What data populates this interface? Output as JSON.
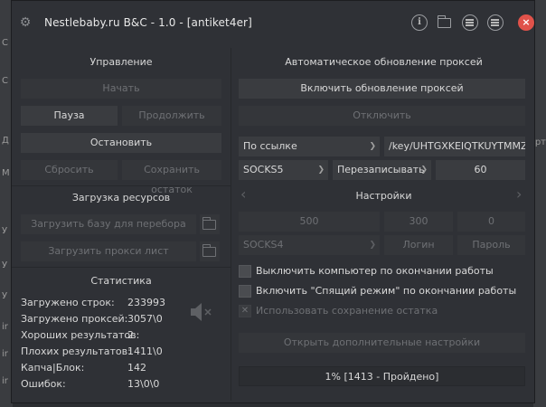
{
  "window": {
    "title": "Nestlebaby.ru B&C - 1.0 - [antiket4er]"
  },
  "background_app": {
    "left_letters": [
      "C",
      "C",
      "Д",
      "М",
      "У",
      "У",
      "У",
      "ir",
      "ir",
      "ir"
    ],
    "right_letters": [
      "рт"
    ]
  },
  "control": {
    "title": "Управление",
    "start": "Начать",
    "pause": "Пауза",
    "resume": "Продолжить",
    "stop": "Остановить",
    "reset": "Сбросить",
    "save_rest": "Сохранить остаток"
  },
  "resources": {
    "title": "Загрузка ресурсов",
    "load_base": "Загрузить базу для перебора",
    "load_proxy": "Загрузить прокси лист"
  },
  "stats": {
    "title": "Статистика",
    "rows": [
      {
        "label": "Загружено строк:",
        "value": "233993"
      },
      {
        "label": "Загружено проксей:",
        "value": "3057\\0"
      },
      {
        "label": "Хороших результатов:",
        "value": "2"
      },
      {
        "label": "Плохих результатов:",
        "value": "1411\\0"
      },
      {
        "label": "Капча|Блок:",
        "value": "142"
      },
      {
        "label": "Ошибок:",
        "value": "13\\0\\0"
      }
    ]
  },
  "proxy_update": {
    "title": "Автоматическое обновление проксей",
    "enable": "Включить обновление проксей",
    "disable": "Отключить",
    "source": "По ссылке",
    "url": "/key/UHTGXKEIQTKUYTMMZIYC",
    "protocol": "SOCKS5",
    "mode": "Перезаписывать",
    "interval": "60"
  },
  "settings": {
    "title": "Настройки",
    "v1": "500",
    "v2": "300",
    "v3": "0",
    "protocol": "SOCKS4",
    "login": "Логин",
    "password": "Пароль",
    "shutdown_label": "Выключить компьютер по окончании работы",
    "sleep_label": "Включить \"Спящий режим\" по окончании работы",
    "save_rest_label": "Использовать сохранение остатка",
    "more_settings": "Открыть дополнительные настройки"
  },
  "progress": {
    "text": "1% [1413 - Пройдено]",
    "percent": 1
  },
  "colors": {
    "close": "#e0524a",
    "window_bg": "#2f3136",
    "button_bg": "#3a3c40"
  },
  "icons": {
    "app": "gear-icon",
    "info": "info-icon",
    "folder": "folder-icon",
    "list": "list-icon",
    "menu": "menu-icon",
    "close": "close-icon",
    "speaker": "speaker-muted-icon"
  }
}
